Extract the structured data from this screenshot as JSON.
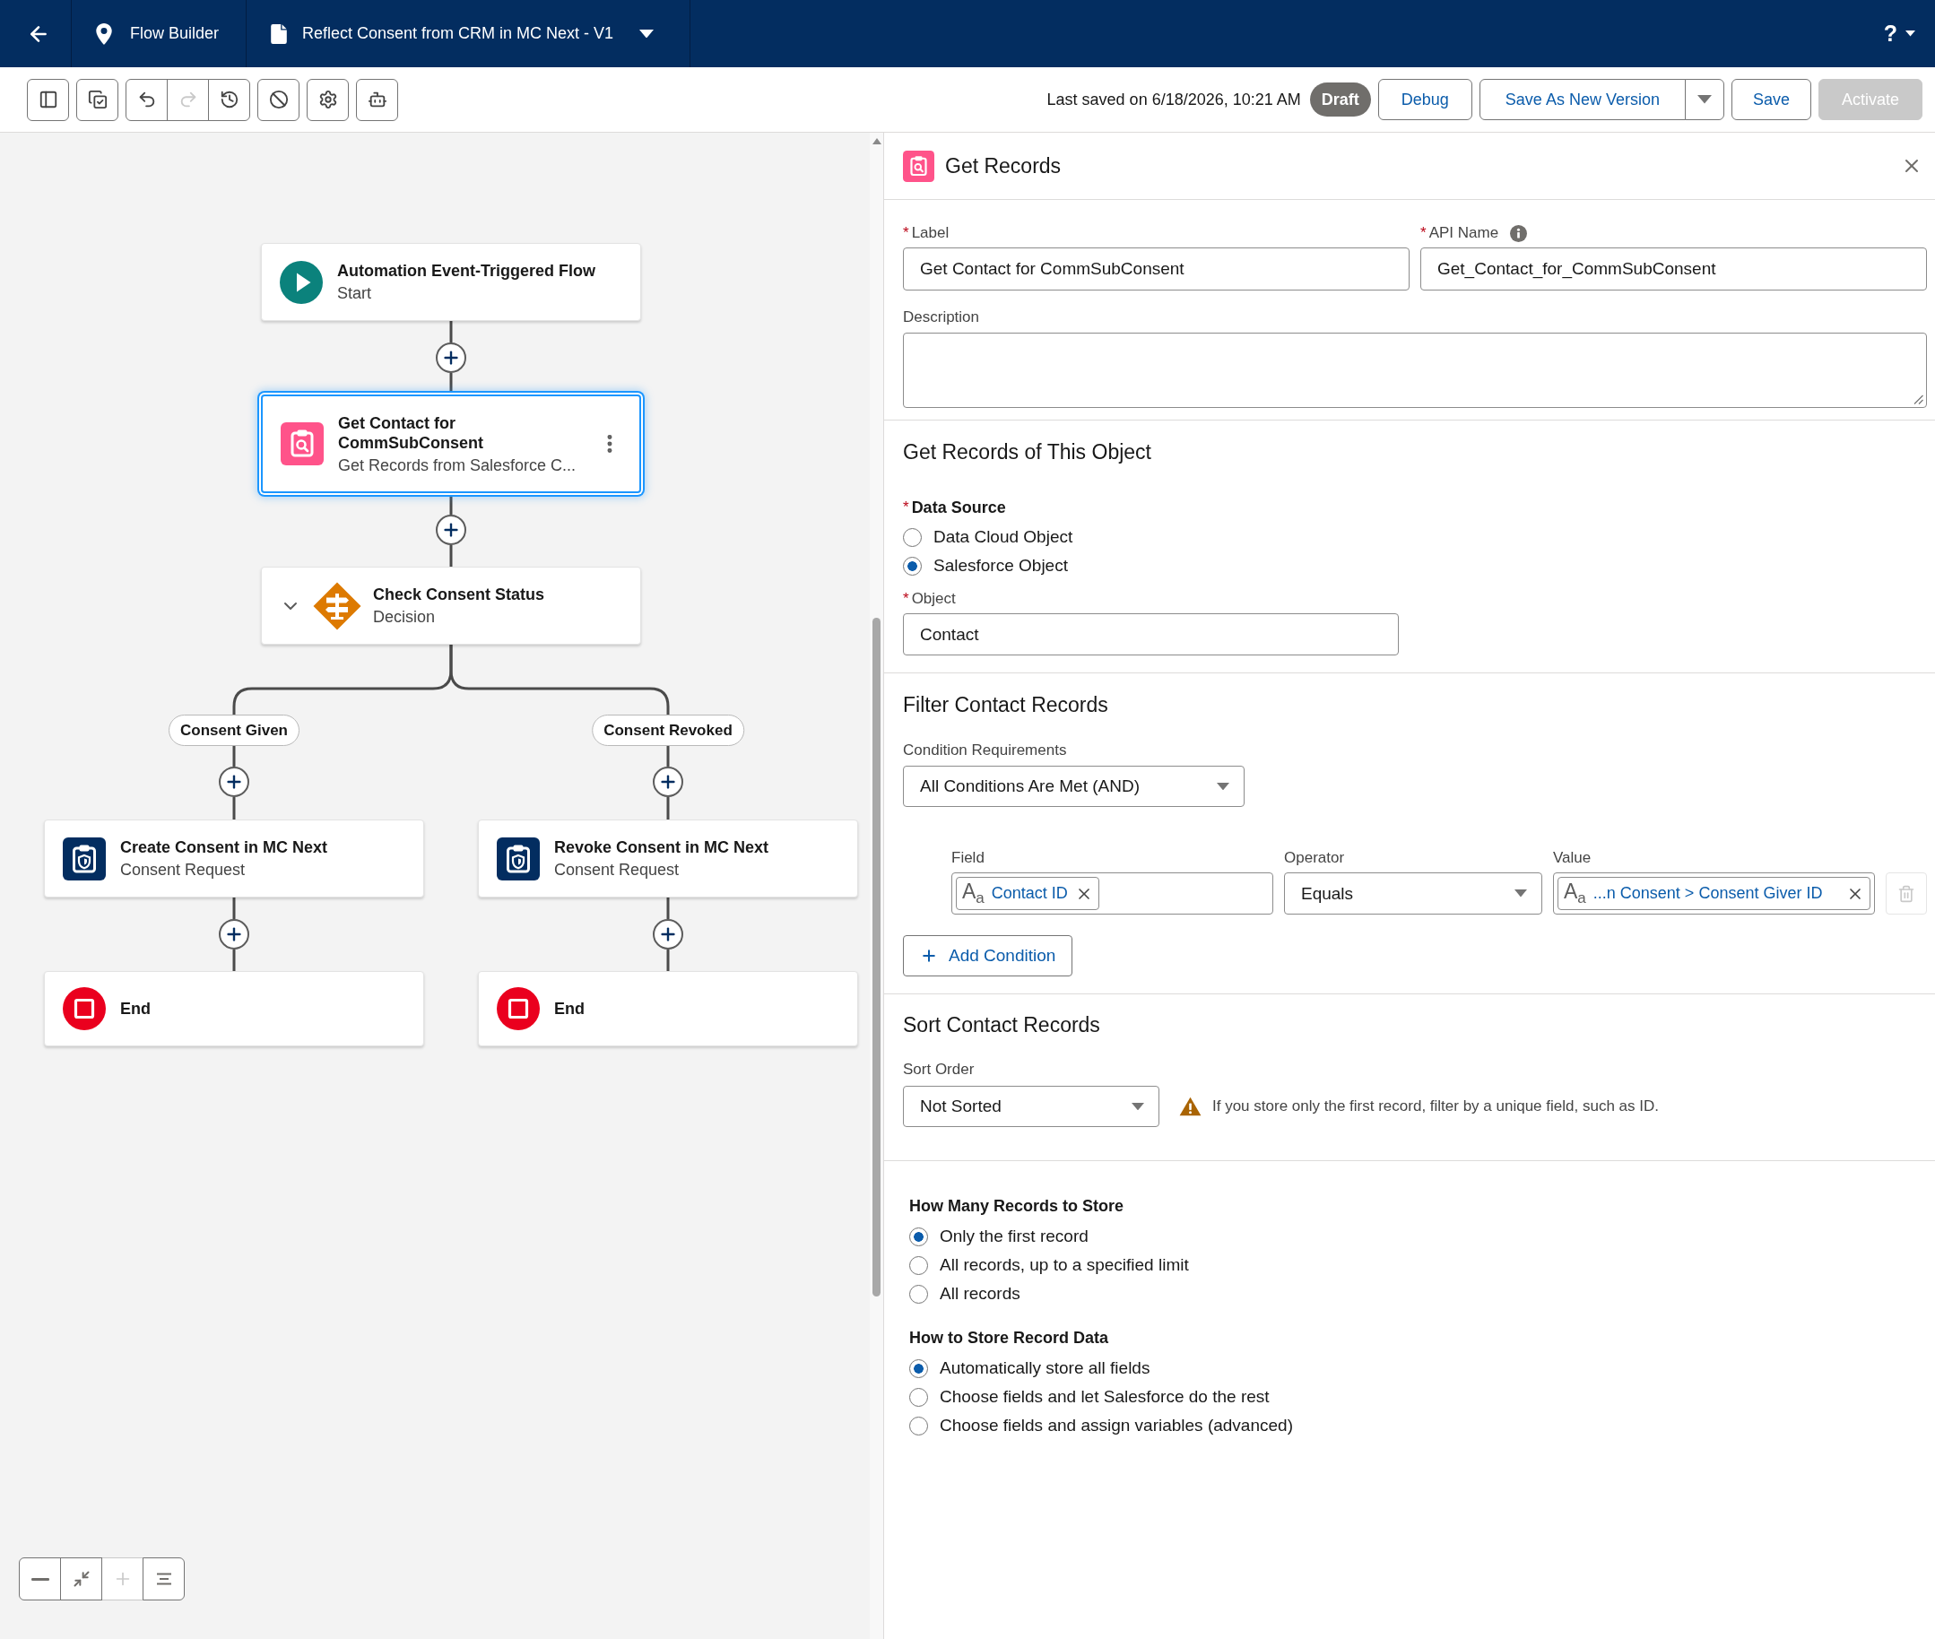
{
  "header": {
    "app_name": "Flow Builder",
    "flow_title": "Reflect Consent from CRM in MC Next - V1",
    "help_label": "?"
  },
  "toolbar": {
    "tool_groups": [
      {
        "tools": [
          {
            "kind": "toggle_panel",
            "disabled": false
          }
        ]
      },
      {
        "tools": [
          {
            "kind": "copy",
            "disabled": false
          }
        ]
      },
      {
        "tools": [
          {
            "kind": "undo",
            "disabled": false
          },
          {
            "kind": "redo",
            "disabled": true
          },
          {
            "kind": "history",
            "disabled": false
          }
        ]
      },
      {
        "tools": [
          {
            "kind": "ban",
            "disabled": false
          }
        ]
      },
      {
        "tools": [
          {
            "kind": "settings",
            "disabled": false
          }
        ]
      },
      {
        "tools": [
          {
            "kind": "agent",
            "disabled": false
          }
        ]
      }
    ],
    "last_saved": "Last saved on 6/18/2026, 10:21 AM",
    "status_badge": "Draft",
    "buttons": [
      {
        "kind": "debug",
        "label": "Debug",
        "disabled": false,
        "has_menu": false
      },
      {
        "kind": "save_as_new",
        "label": "Save As New Version",
        "disabled": false,
        "has_menu": true
      },
      {
        "kind": "save",
        "label": "Save",
        "disabled": false,
        "has_menu": false
      },
      {
        "kind": "activate",
        "label": "Activate",
        "disabled": true,
        "has_menu": false
      }
    ]
  },
  "canvas": {
    "steps": [
      {
        "kind": "start",
        "title": "Automation Event-Triggered Flow",
        "subtitle": "Start",
        "selected": false
      },
      {
        "kind": "get_records",
        "title": "Get Contact for CommSubConsent",
        "subtitle": "Get Records from Salesforce C...",
        "selected": true
      },
      {
        "kind": "decision",
        "title": "Check Consent Status",
        "subtitle": "Decision",
        "selected": false,
        "expanded": true,
        "branches": [
          {
            "label": "Consent Given",
            "steps": [
              {
                "kind": "action",
                "title": "Create Consent in MC Next",
                "subtitle": "Consent Request",
                "selected": false
              },
              {
                "kind": "end",
                "title": "End",
                "selected": false
              }
            ]
          },
          {
            "label": "Consent Revoked",
            "steps": [
              {
                "kind": "action",
                "title": "Revoke Consent in MC Next",
                "subtitle": "Consent Request",
                "selected": false
              },
              {
                "kind": "end",
                "title": "End",
                "selected": false
              }
            ]
          }
        ]
      }
    ],
    "zoom_controls": [
      {
        "kind": "zoom_out",
        "disabled": false
      },
      {
        "kind": "fit",
        "disabled": false
      },
      {
        "kind": "zoom_in",
        "disabled": true
      },
      {
        "kind": "auto_layout",
        "disabled": false
      }
    ]
  },
  "panel": {
    "title": "Get Records",
    "fields": [
      {
        "label": "Label",
        "required_mark": "*",
        "value": "Get Contact for CommSubConsent"
      },
      {
        "label": "API Name",
        "required_mark": "*",
        "value": "Get_Contact_for_CommSubConsent",
        "info": true
      }
    ],
    "description": {
      "label": "Description"
    },
    "object_section": {
      "heading": "Get Records of This Object",
      "data_source": {
        "label": "Data Source",
        "required_mark": "*",
        "options": [
          {
            "label": "Data Cloud Object",
            "selected": false
          },
          {
            "label": "Salesforce Object",
            "selected": true
          }
        ]
      },
      "object": {
        "label": "Object",
        "required_mark": "*",
        "value": "Contact"
      }
    },
    "filter_section": {
      "heading": "Filter Contact Records",
      "requirement": {
        "label": "Condition Requirements",
        "value": "All Conditions Are Met (AND)"
      },
      "columns": [
        "Field",
        "Operator",
        "Value"
      ],
      "conditions": [
        {
          "field_type_icon": "A$_{a}$",
          "field": "Contact ID",
          "operator": "Equals",
          "value_type_icon": "A$_{a}$",
          "value": "...n Consent > Consent Giver ID",
          "delete_disabled": true
        }
      ],
      "add_label": "Add Condition"
    },
    "sort_section": {
      "heading": "Sort Contact Records",
      "sort_order": {
        "label": "Sort Order",
        "value": "Not Sorted"
      },
      "warning": "If you store only the first record, filter by a unique field, such as ID."
    },
    "store_section": {
      "groups": [
        {
          "label": "How Many Records to Store",
          "options": [
            {
              "label": "Only the first record",
              "selected": true
            },
            {
              "label": "All records, up to a specified limit",
              "selected": false
            },
            {
              "label": "All records",
              "selected": false
            }
          ]
        },
        {
          "label": "How to Store Record Data",
          "options": [
            {
              "label": "Automatically store all fields",
              "selected": true
            },
            {
              "label": "Choose fields and let Salesforce do the rest",
              "selected": false
            },
            {
              "label": "Choose fields and assign variables (advanced)",
              "selected": false
            }
          ]
        }
      ]
    }
  }
}
